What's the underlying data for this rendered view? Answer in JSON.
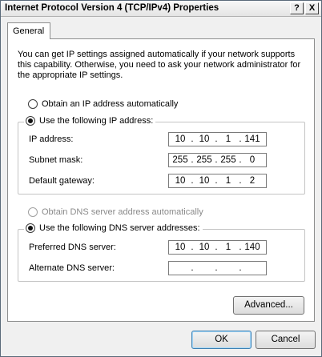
{
  "window": {
    "title": "Internet Protocol Version 4 (TCP/IPv4) Properties",
    "help_glyph": "?",
    "close_glyph": "X"
  },
  "tabs": [
    {
      "label": "General",
      "selected": true
    }
  ],
  "description": "You can get IP settings assigned automatically if your network supports this capability. Otherwise, you need to ask your network administrator for the appropriate IP settings.",
  "ip": {
    "auto_label": "Obtain an IP address automatically",
    "manual_label": "Use the following IP address:",
    "selected": "manual",
    "fields": [
      {
        "label": "IP address:",
        "octets": [
          "10",
          "10",
          "1",
          "141"
        ]
      },
      {
        "label": "Subnet mask:",
        "octets": [
          "255",
          "255",
          "255",
          "0"
        ]
      },
      {
        "label": "Default gateway:",
        "octets": [
          "10",
          "10",
          "1",
          "2"
        ]
      }
    ]
  },
  "dns": {
    "auto_label": "Obtain DNS server address automatically",
    "manual_label": "Use the following DNS server addresses:",
    "selected": "manual",
    "fields": [
      {
        "label": "Preferred DNS server:",
        "octets": [
          "10",
          "10",
          "1",
          "140"
        ]
      },
      {
        "label": "Alternate DNS server:",
        "octets": [
          "",
          "",
          "",
          ""
        ]
      }
    ]
  },
  "octet_separator": ".",
  "buttons": {
    "advanced": "Advanced...",
    "ok": "OK",
    "cancel": "Cancel"
  }
}
